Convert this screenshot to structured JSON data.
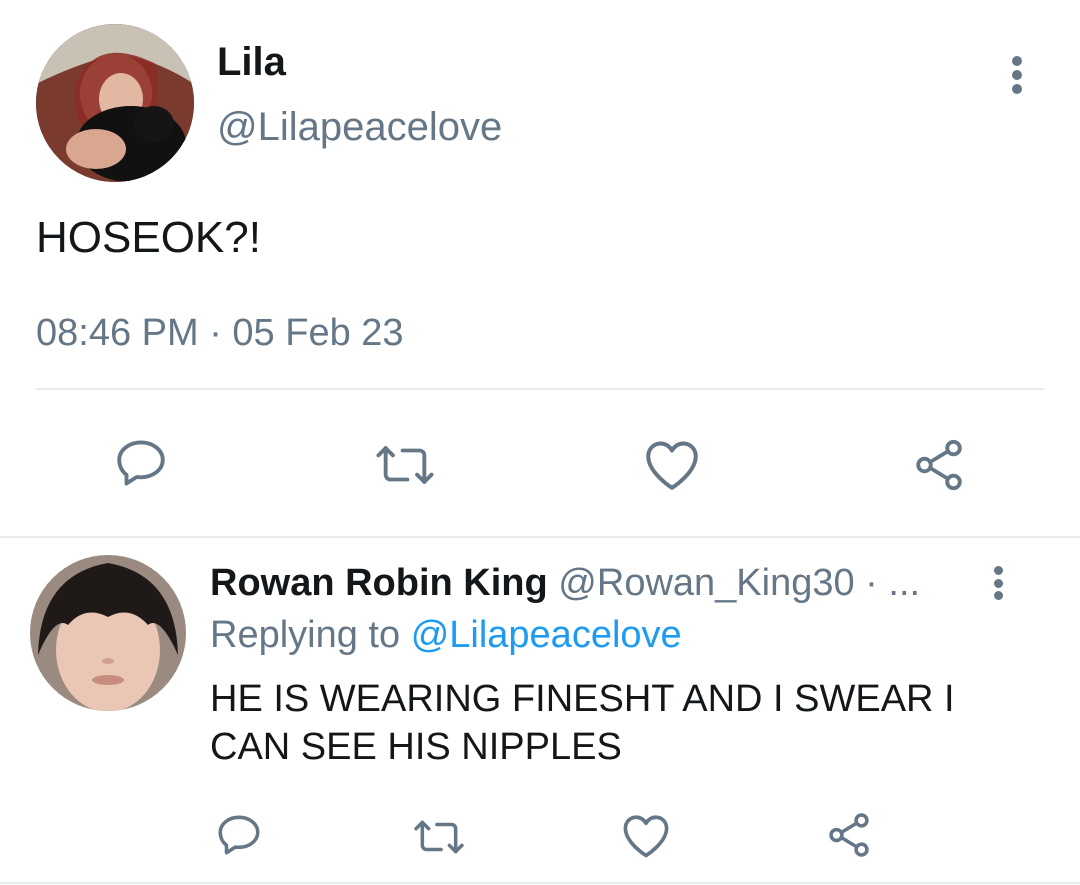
{
  "main_tweet": {
    "author_name": "Lila",
    "handle": "@Lilapeacelove",
    "text": "HOSEOK?!",
    "timestamp": "08:46 PM · 05 Feb 23",
    "actions": [
      "reply",
      "retweet",
      "like",
      "share"
    ]
  },
  "reply_tweet": {
    "author_name": "Rowan Robin King",
    "handle_meta": "@Rowan_King30 · ...",
    "replying_prefix": "Replying to",
    "replying_handle": "@Lilapeacelove",
    "text_line1": "HE IS WEARING FINESHT AND I SWEAR I",
    "text_line2": "CAN SEE HIS NIPPLES",
    "actions": [
      "reply",
      "retweet",
      "like",
      "share"
    ]
  },
  "colors": {
    "text": "#14171a",
    "muted": "#657786",
    "link": "#1d9bf0",
    "divider": "#e6ecf0"
  }
}
